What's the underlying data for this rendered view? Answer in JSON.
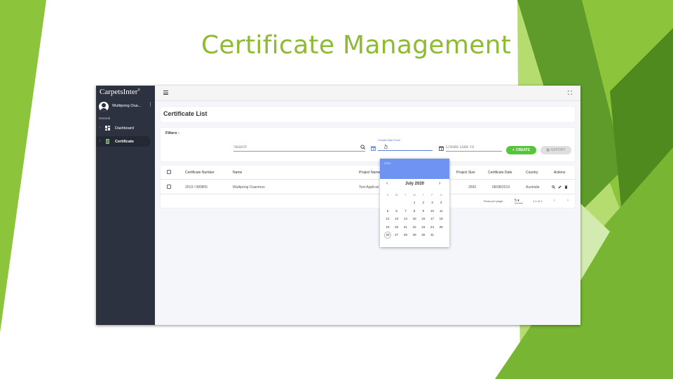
{
  "slide": {
    "title": "Certificate Management",
    "colors": {
      "title": "#8dbb31",
      "accent_green": "#8cc43c",
      "dark_green": "#4f8a1f"
    }
  },
  "app": {
    "logo": "CarpetsInter",
    "logo_mark": "®",
    "user": {
      "name": "Wuttipong Oua...",
      "menu_icon": "kebab-icon"
    },
    "sidebar": {
      "section": "General",
      "items": [
        {
          "label": "Dashboard",
          "icon": "dashboard-icon",
          "active": false
        },
        {
          "label": "Certificate",
          "icon": "document-icon",
          "active": true
        }
      ]
    },
    "topbar": {
      "menu_icon": "hamburger-icon",
      "fullscreen_icon": "fullscreen-icon"
    },
    "page_title": "Certificate List",
    "filters": {
      "label": "Filters :",
      "search_placeholder": "Search",
      "date_from_label": "Create Date From",
      "date_to_placeholder": "Create Date To",
      "create_label": "CREATE",
      "export_label": "EXPORT"
    },
    "table": {
      "columns": [
        "Certificate Number",
        "Name",
        "Project Name",
        "Project Size",
        "Certificate Date",
        "Country",
        "Actions"
      ],
      "rows": [
        {
          "certificate_number": "2019 / 080805",
          "name": "Wuttipong Ouanmun",
          "project_name": "Test Applicat",
          "project_size": "2500",
          "certificate_date": "08/08/2019",
          "country": "Australia",
          "actions": [
            "search-icon",
            "edit-icon",
            "delete-icon"
          ]
        }
      ],
      "footer": {
        "rows_per_page_label": "Rows per page:",
        "rows_per_page": "5",
        "range": "1-1 of 1"
      }
    },
    "date_picker": {
      "year": "2020",
      "month": "July 2020",
      "weekdays": [
        "S",
        "M",
        "T",
        "W",
        "T",
        "F",
        "S"
      ],
      "weeks": [
        [
          "",
          "",
          "",
          "1",
          "2",
          "3",
          "4"
        ],
        [
          "5",
          "6",
          "7",
          "8",
          "9",
          "10",
          "11"
        ],
        [
          "12",
          "13",
          "14",
          "15",
          "16",
          "17",
          "18"
        ],
        [
          "19",
          "20",
          "21",
          "22",
          "23",
          "24",
          "25"
        ],
        [
          "26",
          "27",
          "28",
          "29",
          "30",
          "31",
          ""
        ]
      ],
      "highlighted_day": "26",
      "header_color": "#6f93f2"
    }
  }
}
